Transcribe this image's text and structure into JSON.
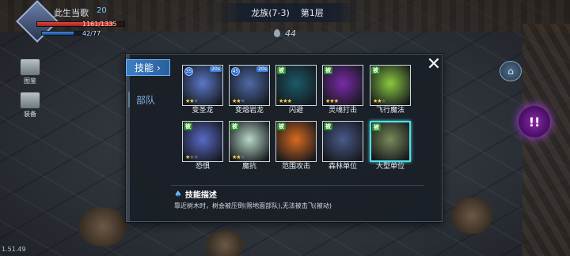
{
  "player": {
    "name": "此生当歌",
    "level": "20",
    "hp": "1161/1335",
    "hp_fraction": 0.87,
    "mp": "42/77",
    "mp_fraction": 0.55
  },
  "side_buttons": [
    {
      "label": "图鉴",
      "icon": "book-icon"
    },
    {
      "label": "装备",
      "icon": "armor-icon"
    }
  ],
  "stage": {
    "name": "龙族(7-3)",
    "floor": "第1层",
    "count": "44"
  },
  "panel": {
    "tabs": [
      {
        "label": "技能",
        "arrow": "›"
      },
      {
        "label": "部队"
      }
    ],
    "close_glyph": "✕",
    "skills": [
      {
        "name": "变圣龙",
        "level": "35",
        "tag": "20s",
        "stars": 2,
        "max_stars": 3,
        "color": "#5a78c8"
      },
      {
        "name": "变熔岩龙",
        "level": "45",
        "tag": "20s",
        "stars": 2,
        "max_stars": 3,
        "color": "#4e6aa8"
      },
      {
        "name": "闪避",
        "badge": "被",
        "stars": 3,
        "max_stars": 3,
        "color": "#1a5a6a"
      },
      {
        "name": "灵魂打击",
        "badge": "被",
        "stars": 3,
        "max_stars": 3,
        "color": "#7a2aa8"
      },
      {
        "name": "飞行魔法",
        "badge": "被",
        "stars": 2,
        "max_stars": 3,
        "color": "#8ac840"
      },
      {
        "name": "恐惧",
        "badge": "被",
        "stars": 1,
        "max_stars": 3,
        "color": "#5a6ac8"
      },
      {
        "name": "魔抗",
        "badge": "被",
        "stars": 2,
        "max_stars": 3,
        "color": "#b8d8c8"
      },
      {
        "name": "范围攻击",
        "badge": "被",
        "stars": 0,
        "max_stars": 0,
        "color": "#d86a20"
      },
      {
        "name": "森林单位",
        "badge": "被",
        "stars": 0,
        "max_stars": 0,
        "color": "#4a5a8a"
      },
      {
        "name": "大型单位",
        "badge": "被",
        "stars": 0,
        "max_stars": 0,
        "color": "#7a8a5a",
        "selected": true
      }
    ],
    "description": {
      "title": "技能描述",
      "text": "靠近树木时，树会被压倒(限地面部队),无法被击飞(被动)"
    }
  },
  "right_buttons": [
    {
      "icon": "tombstone-icon",
      "glyph": "⌂"
    },
    {
      "icon": "magic-icon",
      "glyph": "!!"
    }
  ],
  "version": "1.51.49"
}
